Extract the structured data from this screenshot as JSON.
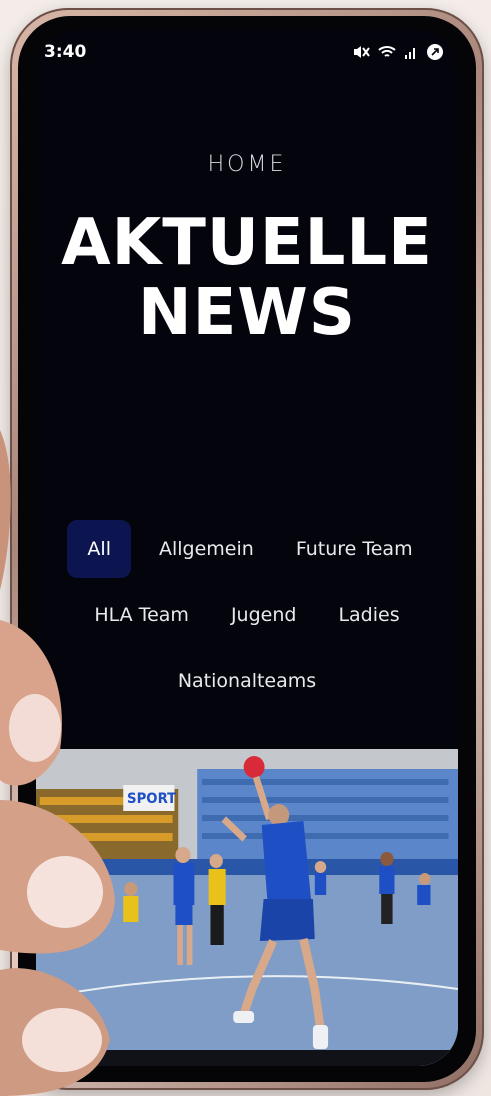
{
  "status": {
    "time": "3:40"
  },
  "header": {
    "home_label": "HOME",
    "title_line1": "AKTUELLE",
    "title_line2": "NEWS"
  },
  "filters": {
    "row1": [
      "All",
      "Allgemein",
      "Future Team"
    ],
    "row2": [
      "HLA Team",
      "Jugend",
      "Ladies"
    ],
    "row3": [
      "Nationalteams"
    ],
    "active": "All"
  },
  "colors": {
    "screen_bg": "#04040c",
    "active_chip": "#0c1550",
    "jersey_blue": "#1e4fc4",
    "jersey_yellow": "#e8c21a"
  },
  "photo": {
    "banner_text": "SPORT"
  }
}
